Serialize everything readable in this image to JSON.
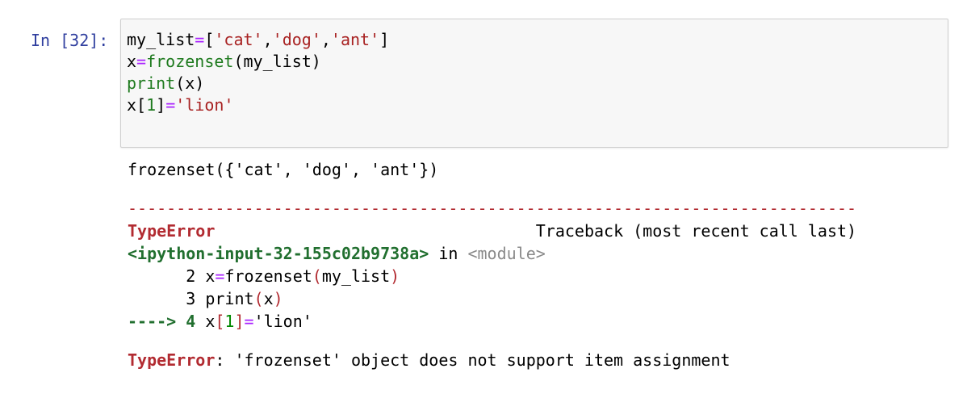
{
  "prompt": "In [32]:",
  "code_lines": [
    [
      {
        "t": "my_list",
        "c": "plain"
      },
      {
        "t": "=",
        "c": "op"
      },
      {
        "t": "[",
        "c": "plain"
      },
      {
        "t": "'cat'",
        "c": "str"
      },
      {
        "t": ",",
        "c": "plain"
      },
      {
        "t": "'dog'",
        "c": "str"
      },
      {
        "t": ",",
        "c": "plain"
      },
      {
        "t": "'ant'",
        "c": "str"
      },
      {
        "t": "]",
        "c": "plain"
      }
    ],
    [
      {
        "t": "x",
        "c": "plain"
      },
      {
        "t": "=",
        "c": "op"
      },
      {
        "t": "frozenset",
        "c": "func"
      },
      {
        "t": "(my_list)",
        "c": "plain"
      }
    ],
    [
      {
        "t": "print",
        "c": "func"
      },
      {
        "t": "(x)",
        "c": "plain"
      }
    ],
    [
      {
        "t": "x[",
        "c": "plain"
      },
      {
        "t": "1",
        "c": "num"
      },
      {
        "t": "]",
        "c": "plain"
      },
      {
        "t": "=",
        "c": "op"
      },
      {
        "t": "'lion'",
        "c": "str"
      }
    ]
  ],
  "output": {
    "stdout": "frozenset({'cat', 'dog', 'ant'})",
    "separator": "---------------------------------------------------------------------------",
    "error_name": "TypeError",
    "traceback_header": "Traceback (most recent call last)",
    "location_file": "<ipython-input-32-155c02b9738a>",
    "location_in": " in ",
    "location_module": "<module>",
    "tb_line2_prefix": "      2 x",
    "tb_line2_eq": "=",
    "tb_line2_func": "frozenset",
    "tb_line2_open": "(",
    "tb_line2_arg": "my_list",
    "tb_line2_close": ")",
    "tb_line3_prefix": "      3 ",
    "tb_line3_func": "print",
    "tb_line3_open": "(",
    "tb_line3_arg": "x",
    "tb_line3_close": ")",
    "tb_arrow": "----> 4 ",
    "tb_line4_x": "x",
    "tb_line4_lb": "[",
    "tb_line4_num": "1",
    "tb_line4_rb": "]",
    "tb_line4_eq": "=",
    "tb_line4_str": "'lion'",
    "final_error_name": "TypeError",
    "final_error_msg": ": 'frozenset' object does not support item assignment"
  },
  "colors": {
    "prompt": "#303f9f",
    "string": "#a82222",
    "operator": "#aa22ff",
    "builtin": "#1e7a1e",
    "error": "#b22b31",
    "traceback_file": "#216f2f",
    "muted": "#8a8a8a"
  }
}
